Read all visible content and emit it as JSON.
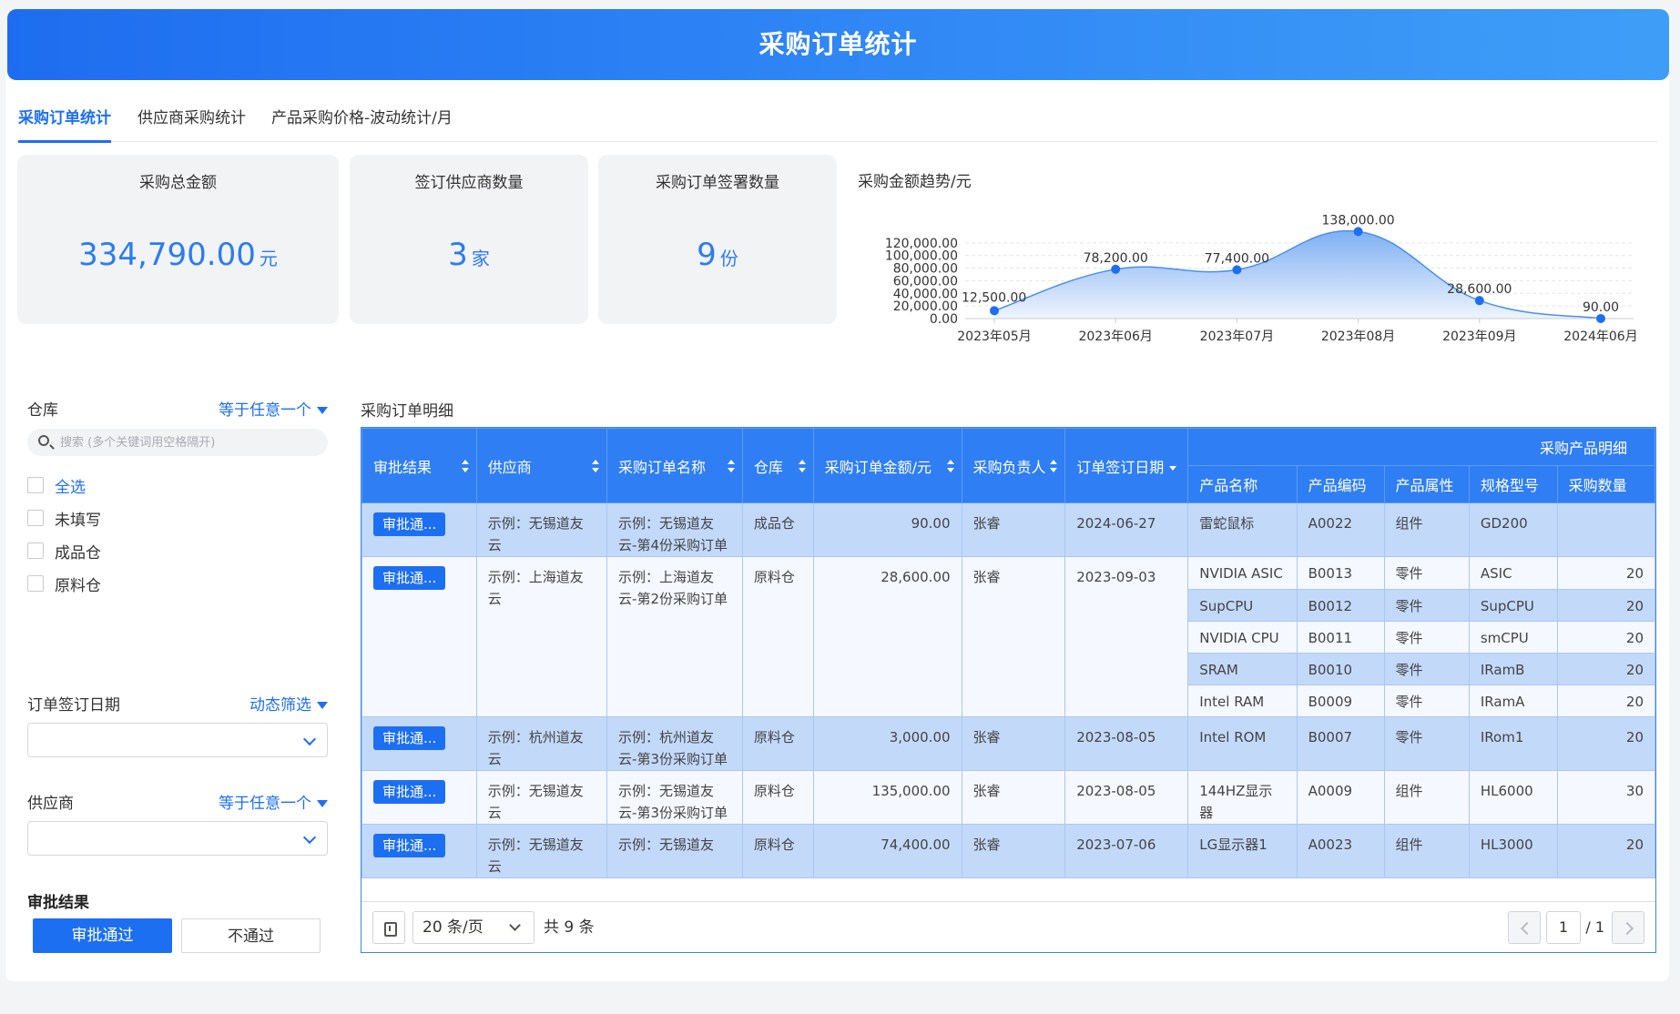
{
  "header": {
    "title": "采购订单统计"
  },
  "tabs": [
    {
      "label": "采购订单统计",
      "active": true
    },
    {
      "label": "供应商采购统计",
      "active": false
    },
    {
      "label": "产品采购价格-波动统计/月",
      "active": false
    }
  ],
  "kpis": [
    {
      "label": "采购总金额",
      "value": "334,790.00",
      "unit": "元"
    },
    {
      "label": "签订供应商数量",
      "value": "3",
      "unit": "家"
    },
    {
      "label": "采购订单签署数量",
      "value": "9",
      "unit": "份"
    }
  ],
  "chart_data": {
    "type": "area",
    "title": "采购金额趋势/元",
    "x": [
      "2023年05月",
      "2023年06月",
      "2023年07月",
      "2023年08月",
      "2023年09月",
      "2024年06月"
    ],
    "values": [
      12500,
      78200,
      77400,
      138000,
      28600,
      90
    ],
    "data_labels": [
      "12,500.00",
      "78,200.00",
      "77,400.00",
      "138,000.00",
      "28,600.00",
      "90.00"
    ],
    "y_ticks": [
      "0.00",
      "20,000.00",
      "40,000.00",
      "60,000.00",
      "80,000.00",
      "100,000.00",
      "120,000.00"
    ],
    "ylim": [
      0,
      120000
    ],
    "grid": true,
    "colors": {
      "line": "#4a8ff0",
      "point": "#1d6ff2",
      "fill_top": "#7fb0f4",
      "fill_bottom": "#eef4fd"
    }
  },
  "filters": {
    "warehouse": {
      "label": "仓库",
      "operator": "等于任意一个",
      "search_placeholder": "搜索 (多个关键词用空格隔开)",
      "options": [
        "全选",
        "未填写",
        "成品仓",
        "原料仓"
      ]
    },
    "sign_date": {
      "label": "订单签订日期",
      "operator": "动态筛选"
    },
    "supplier": {
      "label": "供应商",
      "operator": "等于任意一个"
    },
    "approval": {
      "label": "审批结果",
      "pass_label": "审批通过",
      "reject_label": "不通过"
    }
  },
  "table": {
    "title": "采购订单明细",
    "group_header": "采购产品明细",
    "columns": [
      "审批结果",
      "供应商",
      "采购订单名称",
      "仓库",
      "采购订单金额/元",
      "采购负责人",
      "订单签订日期"
    ],
    "sub_columns": [
      "产品名称",
      "产品编码",
      "产品属性",
      "规格型号",
      "采购数量"
    ],
    "orders": [
      {
        "status": "审批通...",
        "supplier": "示例：无锡道友云",
        "name": "示例：无锡道友云-第4份采购订单",
        "warehouse": "成品仓",
        "amount": "90.00",
        "owner": "张睿",
        "date": "2024-06-27",
        "products": [
          {
            "name": "雷蛇鼠标",
            "code": "A0022",
            "attr": "组件",
            "spec": "GD200",
            "qty": ""
          }
        ]
      },
      {
        "status": "审批通...",
        "supplier": "示例：上海道友云",
        "name": "示例：上海道友云-第2份采购订单",
        "warehouse": "原料仓",
        "amount": "28,600.00",
        "owner": "张睿",
        "date": "2023-09-03",
        "products": [
          {
            "name": "NVIDIA ASIC",
            "code": "B0013",
            "attr": "零件",
            "spec": "ASIC",
            "qty": "20"
          },
          {
            "name": "SupCPU",
            "code": "B0012",
            "attr": "零件",
            "spec": "SupCPU",
            "qty": "20"
          },
          {
            "name": "NVIDIA CPU",
            "code": "B0011",
            "attr": "零件",
            "spec": "smCPU",
            "qty": "20"
          },
          {
            "name": "SRAM",
            "code": "B0010",
            "attr": "零件",
            "spec": "IRamB",
            "qty": "20"
          },
          {
            "name": "Intel RAM",
            "code": "B0009",
            "attr": "零件",
            "spec": "IRamA",
            "qty": "20"
          }
        ]
      },
      {
        "status": "审批通...",
        "supplier": "示例：杭州道友云",
        "name": "示例：杭州道友云-第3份采购订单",
        "warehouse": "原料仓",
        "amount": "3,000.00",
        "owner": "张睿",
        "date": "2023-08-05",
        "products": [
          {
            "name": "Intel ROM",
            "code": "B0007",
            "attr": "零件",
            "spec": "IRom1",
            "qty": "20"
          }
        ]
      },
      {
        "status": "审批通...",
        "supplier": "示例：无锡道友云",
        "name": "示例：无锡道友云-第3份采购订单",
        "warehouse": "原料仓",
        "amount": "135,000.00",
        "owner": "张睿",
        "date": "2023-08-05",
        "products": [
          {
            "name": "144HZ显示器",
            "code": "A0009",
            "attr": "组件",
            "spec": "HL6000",
            "qty": "30"
          }
        ]
      },
      {
        "status": "审批通...",
        "supplier": "示例：无锡道友云",
        "name": "示例：无锡道友",
        "warehouse": "原料仓",
        "amount": "74,400.00",
        "owner": "张睿",
        "date": "2023-07-06",
        "products": [
          {
            "name": "LG显示器1",
            "code": "A0023",
            "attr": "组件",
            "spec": "HL3000",
            "qty": "20"
          }
        ]
      }
    ]
  },
  "pagination": {
    "page_size": "20 条/页",
    "total": "共 9 条",
    "current": "1",
    "of": "/ 1"
  }
}
